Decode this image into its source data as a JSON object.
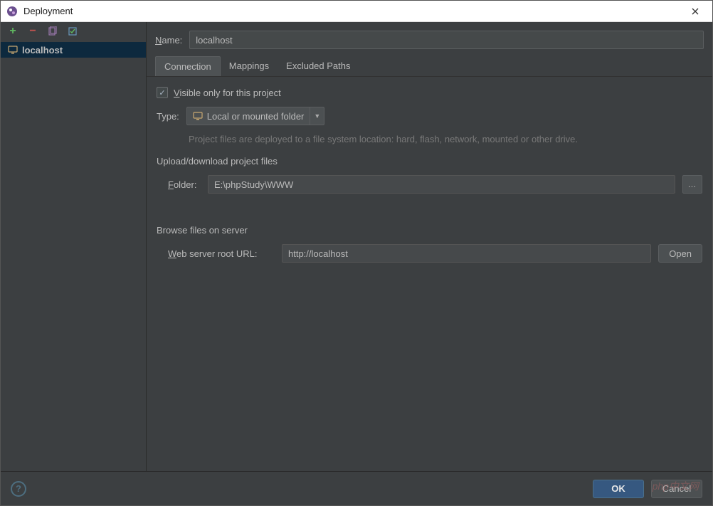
{
  "window": {
    "title": "Deployment"
  },
  "sidebar": {
    "items": [
      {
        "label": "localhost"
      }
    ]
  },
  "nameRow": {
    "label": "Name:",
    "value": "localhost"
  },
  "tabs": {
    "connection": "Connection",
    "mappings": "Mappings",
    "excluded": "Excluded Paths"
  },
  "visibleOnly": {
    "label": "Visible only for this project",
    "checked": true
  },
  "type": {
    "label": "Type:",
    "value": "Local or mounted folder",
    "hint": "Project files are deployed to a file system location: hard, flash, network, mounted or other drive."
  },
  "upload": {
    "title": "Upload/download project files"
  },
  "folder": {
    "label": "Folder:",
    "value": "E:\\phpStudy\\WWW"
  },
  "browse": {
    "title": "Browse files on server"
  },
  "webroot": {
    "label": "Web server root URL:",
    "value": "http://localhost"
  },
  "buttons": {
    "open": "Open",
    "ok": "OK",
    "cancel": "Cancel"
  },
  "watermark": "php中文网"
}
